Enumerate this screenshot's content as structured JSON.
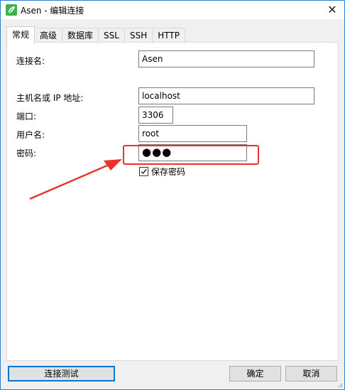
{
  "window": {
    "title": "Asen - 编辑连接",
    "close_glyph": "✕"
  },
  "tabs": [
    {
      "label": "常规",
      "active": true
    },
    {
      "label": "高级",
      "active": false
    },
    {
      "label": "数据库",
      "active": false
    },
    {
      "label": "SSL",
      "active": false
    },
    {
      "label": "SSH",
      "active": false
    },
    {
      "label": "HTTP",
      "active": false
    }
  ],
  "form": {
    "connection_name": {
      "label": "连接名:",
      "value": "Asen"
    },
    "host": {
      "label": "主机名或 IP 地址:",
      "value": "localhost"
    },
    "port": {
      "label": "端口:",
      "value": "3306"
    },
    "username": {
      "label": "用户名:",
      "value": "root"
    },
    "password": {
      "label": "密码:",
      "value": "●●●"
    },
    "save_password": {
      "label": "保存密码",
      "checked": true
    }
  },
  "buttons": {
    "test_connection": "连接测试",
    "ok": "确定",
    "cancel": "取消"
  },
  "colors": {
    "annotation_red": "#e8322b",
    "app_icon_green": "#3bb34a",
    "window_border": "#2b7fd6"
  },
  "icons": {
    "app": "navicat-leaf-icon",
    "close": "close-icon",
    "check": "checkmark-icon",
    "annotation_arrow": "red-arrow-annotation"
  }
}
